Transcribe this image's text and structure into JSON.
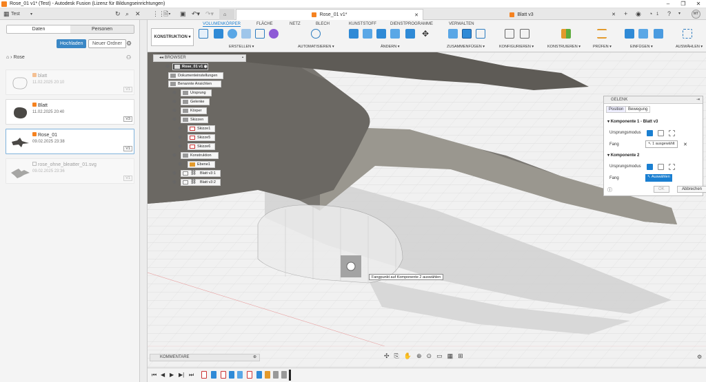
{
  "window": {
    "title": "Rose_01 v1* (Test) - Autodesk Fusion (Lizenz für Bildungseinrichtungen)"
  },
  "topbar": {
    "project": "Test",
    "tabs": [
      {
        "label": "Rose_01 v1*",
        "active": true
      },
      {
        "label": "Blatt v3",
        "active": false
      }
    ],
    "notif_count": "1",
    "user_initials": "MT"
  },
  "data_panel": {
    "tabs": [
      "Daten",
      "Personen"
    ],
    "upload_label": "Hochladen",
    "new_folder_label": "Neuer Ordner",
    "breadcrumb": "Rose",
    "items": [
      {
        "name": "blatt",
        "date": "11.02.2025 20:10",
        "version": "V1",
        "selected": false,
        "faded": true
      },
      {
        "name": "Blatt",
        "date": "11.02.2025 20:40",
        "version": "V3",
        "selected": false,
        "faded": false
      },
      {
        "name": "Rose_01",
        "date": "09.02.2025 23:38",
        "version": "V1",
        "selected": true,
        "faded": false
      },
      {
        "name": "rose_ohne_bleatter_01.svg",
        "date": "09.02.2025 23:36",
        "version": "V1",
        "selected": false,
        "faded": true
      }
    ]
  },
  "ribbon": {
    "workspace": "KONSTRUKTION",
    "tabs": [
      "VOLUMENKÖRPER",
      "FLÄCHE",
      "NETZ",
      "BLECH",
      "KUNSTSTOFF",
      "DIENSTPROGRAMME",
      "VERWALTEN"
    ],
    "active_tab": "VOLUMENKÖRPER",
    "groups": [
      "ERSTELLEN",
      "AUTOMATISIEREN",
      "ÄNDERN",
      "ZUSAMMENFÜGEN",
      "KONFIGURIEREN",
      "KONSTRUIEREN",
      "PRÜFEN",
      "EINFÜGEN",
      "AUSWÄHLEN"
    ]
  },
  "browser": {
    "title": "BROWSER",
    "root": "Rose_01 v1",
    "nodes": [
      "Dokumenteinstellungen",
      "Benannte Ansichten",
      "Ursprung",
      "Gelenke",
      "Körper",
      "Skizzen",
      "Skizze1",
      "Skizze5",
      "Skizze6",
      "Konstruktion",
      "Ebene1",
      "Blatt v3:1",
      "Blatt v3:2"
    ]
  },
  "joint_panel": {
    "title": "GELENK",
    "tabs": [
      "Position",
      "Bewegung"
    ],
    "component1": "Komponente 1 - Blatt v3",
    "origin_mode_label": "Ursprungsmodus",
    "snap_label": "Fang",
    "snap1_value": "1 ausgewählt",
    "component2": "Komponente 2",
    "snap2_value": "Auswählen",
    "ok_label": "OK",
    "cancel_label": "Abbrechen"
  },
  "tooltip": "Fangpunkt auf Komponente 2 auswählen",
  "comments_label": "KOMMENTARE",
  "colors": {
    "accent": "#1a7fd1",
    "brand": "#f58220",
    "model_dark": "#6f6c66",
    "model_light": "#a9a6a0"
  }
}
